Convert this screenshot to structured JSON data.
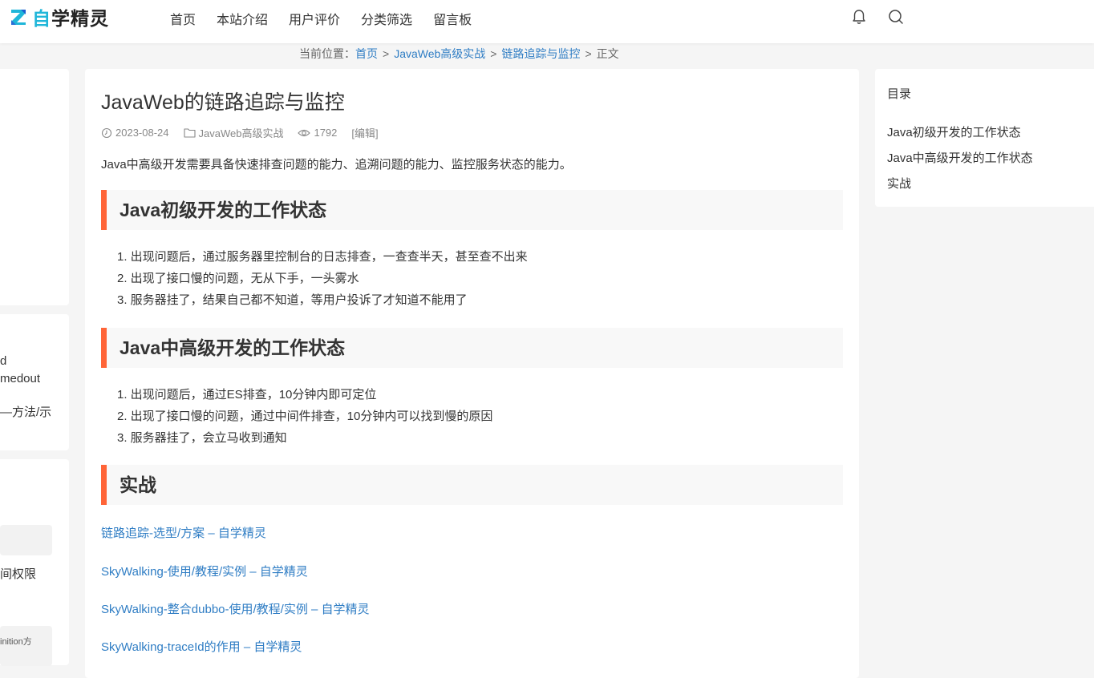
{
  "header": {
    "logo": {
      "prefix": "自",
      "rest": "学精灵"
    },
    "nav": [
      "首页",
      "本站介绍",
      "用户评价",
      "分类筛选",
      "留言板"
    ],
    "icons": [
      "bell-icon",
      "search-icon"
    ]
  },
  "breadcrumb": {
    "prefix": "当前位置：",
    "items": [
      "首页",
      "JavaWeb高级实战",
      "链路追踪与监控"
    ],
    "current": "正文"
  },
  "left_sidebar_fragments": [
    "d",
    "medout",
    "—方法/示",
    "间权限",
    "inition方"
  ],
  "article": {
    "title": "JavaWeb的链路追踪与监控",
    "meta": {
      "date": "2023-08-24",
      "category": "JavaWeb高级实战",
      "views": "1792",
      "edit": "[编辑]"
    },
    "intro": "Java中高级开发需要具备快速排查问题的能力、追溯问题的能力、监控服务状态的能力。",
    "sections": [
      {
        "heading": "Java初级开发的工作状态",
        "items": [
          "1. 出现问题后，通过服务器里控制台的日志排查，一查查半天，甚至查不出来",
          "2. 出现了接口慢的问题，无从下手，一头雾水",
          "3. 服务器挂了，结果自己都不知道，等用户投诉了才知道不能用了"
        ]
      },
      {
        "heading": "Java中高级开发的工作状态",
        "items": [
          "1. 出现问题后，通过ES排查，10分钟内即可定位",
          "2. 出现了接口慢的问题，通过中间件排查，10分钟内可以找到慢的原因",
          "3. 服务器挂了，会立马收到通知"
        ]
      },
      {
        "heading": "实战",
        "items": []
      }
    ],
    "links": [
      "链路追踪-选型/方案 – 自学精灵",
      "SkyWalking-使用/教程/实例 – 自学精灵",
      "SkyWalking-整合dubbo-使用/教程/实例 – 自学精灵",
      "SkyWalking-traceId的作用 – 自学精灵"
    ]
  },
  "toc": {
    "title": "目录",
    "items": [
      "Java初级开发的工作状态",
      "Java中高级开发的工作状态",
      "实战"
    ]
  },
  "colors": {
    "accent": "#ff6437",
    "link": "#2f7dc4",
    "logo": "#1fb6d9"
  }
}
